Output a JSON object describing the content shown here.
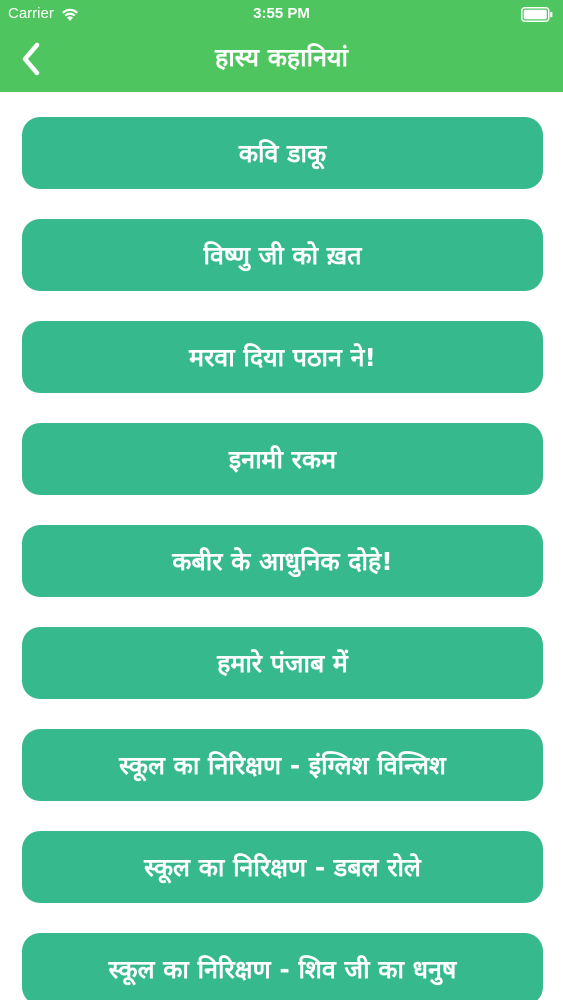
{
  "colors": {
    "header_bg": "#4fc55f",
    "item_bg": "#37b98e",
    "text": "#ffffff"
  },
  "status_bar": {
    "carrier": "Carrier",
    "time": "3:55 PM",
    "wifi_icon": "wifi-icon",
    "battery_icon": "battery-icon"
  },
  "nav": {
    "back_icon": "chevron-left-icon",
    "title": "हास्य कहानियां"
  },
  "stories": [
    "कवि डाकू",
    "विष्णु जी को ख़त",
    "मरवा दिया पठान ने!",
    "इनामी रकम",
    "कबीर के आधुनिक दोहे!",
    "हमारे पंजाब में",
    "स्कूल का निरिक्षण  - इंग्लिश विन्लिश",
    "स्कूल का निरिक्षण  - डबल रोले",
    "स्कूल का निरिक्षण  - शिव जी का धनुष"
  ]
}
